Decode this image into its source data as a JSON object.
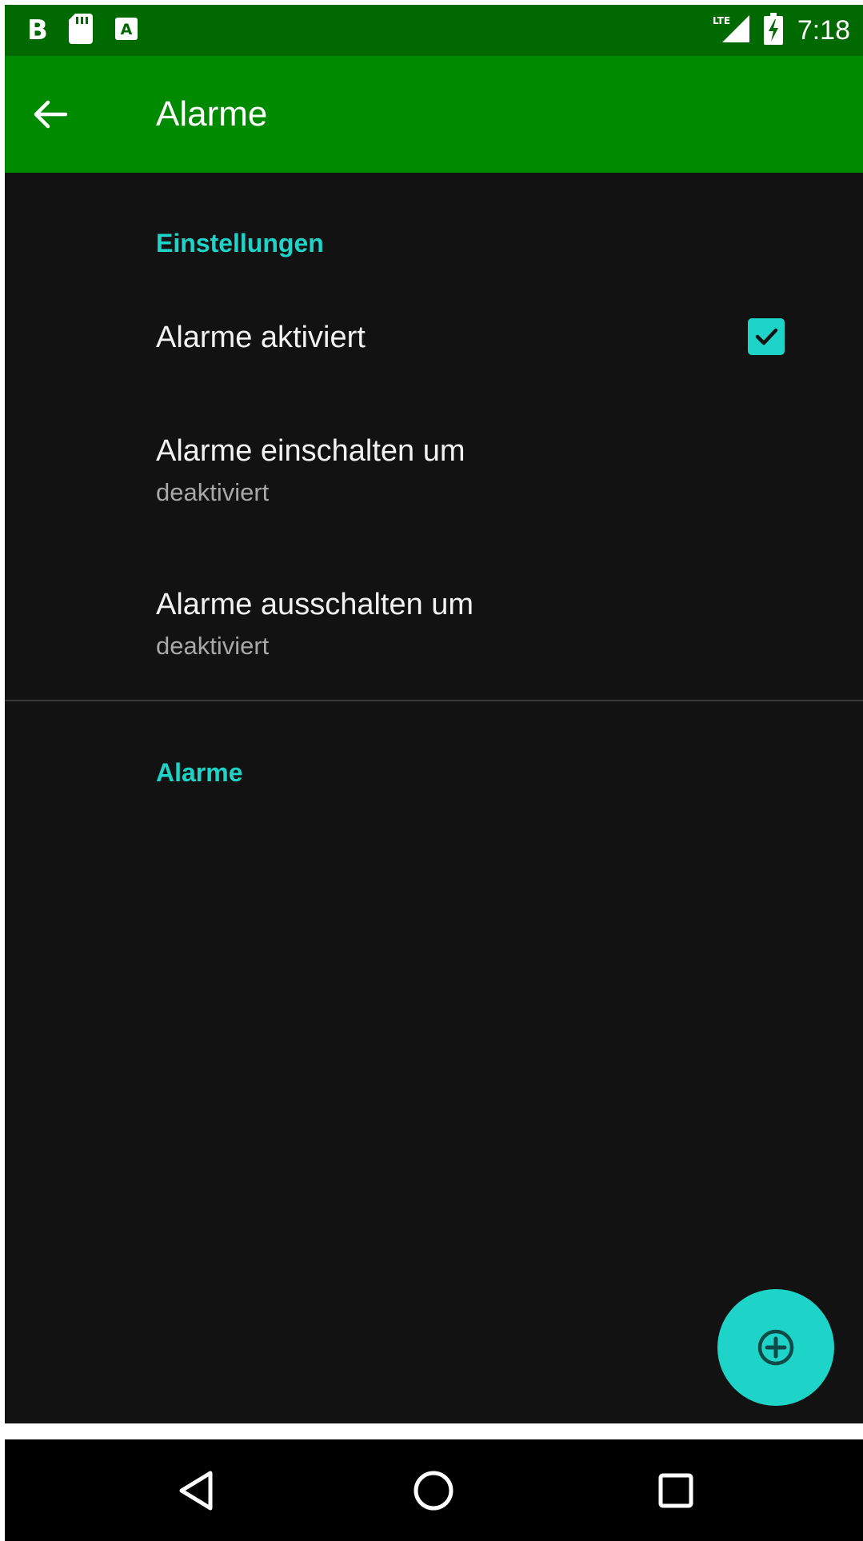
{
  "status_bar": {
    "left_icons": [
      "b-notification-icon",
      "sd-card-icon",
      "a-notification-icon"
    ],
    "b_glyph": "B",
    "network_label": "LTE",
    "time": "7:18"
  },
  "app_bar": {
    "title": "Alarme",
    "background": "#008a00"
  },
  "settings": {
    "header": "Einstellungen",
    "items": [
      {
        "title": "Alarme aktiviert",
        "checked": true
      },
      {
        "title": "Alarme einschalten um",
        "summary": "deaktiviert"
      },
      {
        "title": "Alarme ausschalten um",
        "summary": "deaktiviert"
      }
    ]
  },
  "alarms": {
    "header": "Alarme"
  },
  "fab": {
    "icon": "add-circle-icon",
    "color": "#1ed3c7"
  },
  "nav_bar": {
    "icons": [
      "back-triangle-icon",
      "home-circle-icon",
      "recents-square-icon"
    ]
  },
  "colors": {
    "accent": "#1ed3c7",
    "status_bar": "#006900",
    "background": "#121212"
  }
}
